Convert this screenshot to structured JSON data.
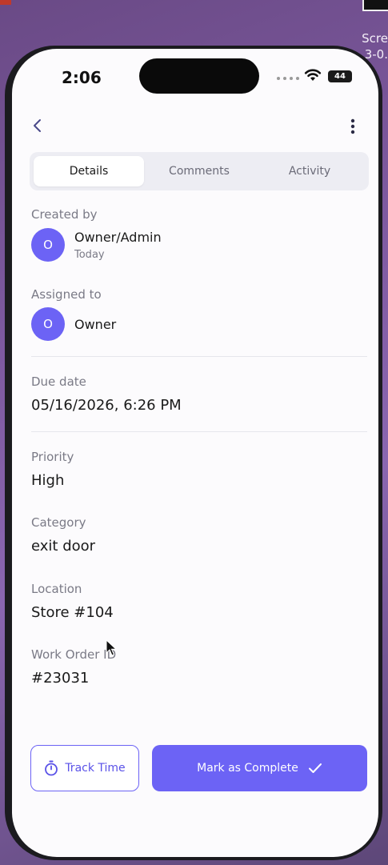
{
  "desktop": {
    "snippet_line1": "Scre",
    "snippet_line2": "3-0."
  },
  "status_bar": {
    "time": "2:06",
    "battery": "44"
  },
  "tabs": [
    {
      "label": "Details",
      "active": true
    },
    {
      "label": "Comments",
      "active": false
    },
    {
      "label": "Activity",
      "active": false
    }
  ],
  "created_by": {
    "label": "Created by",
    "avatar": "O",
    "name": "Owner/Admin",
    "sub": "Today"
  },
  "assigned_to": {
    "label": "Assigned to",
    "avatar": "O",
    "name": "Owner"
  },
  "due_date": {
    "label": "Due date",
    "value": "05/16/2026, 6:26 PM"
  },
  "priority": {
    "label": "Priority",
    "value": "High"
  },
  "category": {
    "label": "Category",
    "value": "exit door"
  },
  "location": {
    "label": "Location",
    "value": "Store #104"
  },
  "work_order": {
    "label": "Work Order ID",
    "value": "#23031"
  },
  "actions": {
    "track_time": "Track Time",
    "mark_complete": "Mark as Complete"
  },
  "colors": {
    "accent": "#6c63f5",
    "background": "#fcfbfd"
  }
}
